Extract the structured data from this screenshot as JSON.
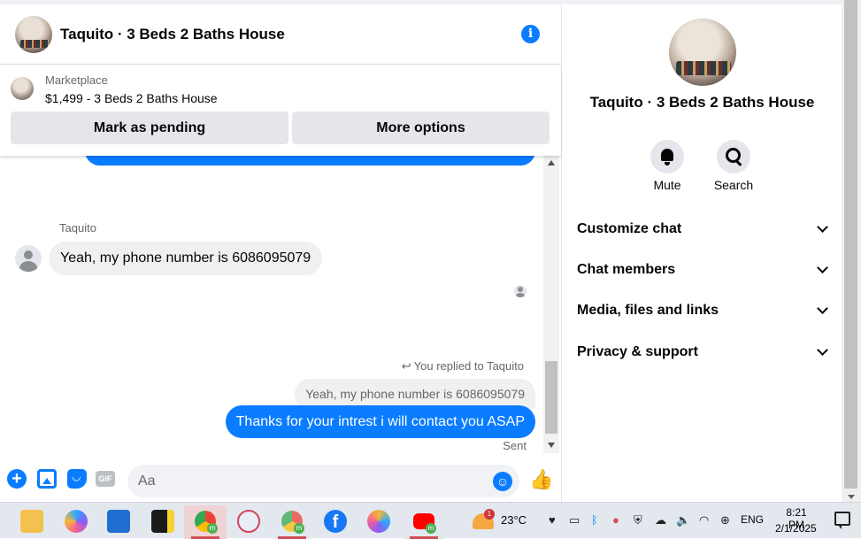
{
  "chat": {
    "title": "Taquito · 3 Beds 2 Baths House",
    "marketplace": {
      "source": "Marketplace",
      "listing": "$1,499 - 3 Beds 2 Baths House",
      "pending_label": "Mark as pending",
      "more_label": "More options"
    },
    "messages": {
      "sender_name": "Taquito",
      "incoming_text": "Yeah, my phone number is 6086095079",
      "replied_label": "You replied to Taquito",
      "quoted_text": "Yeah, my phone number is 6086095079",
      "outgoing_text": "Thanks for your intrest i will contact you ASAP",
      "status": "Sent"
    },
    "composer": {
      "placeholder": "Aa",
      "gif_label": "GIF"
    }
  },
  "info_panel": {
    "name": "Taquito · 3 Beds 2 Baths House",
    "actions": [
      {
        "label": "Mute",
        "icon": "bell-icon"
      },
      {
        "label": "Search",
        "icon": "search-icon"
      }
    ],
    "sections": [
      "Customize chat",
      "Chat members",
      "Media, files and links",
      "Privacy & support"
    ]
  },
  "taskbar": {
    "weather_temp": "23°C",
    "weather_badge": "1",
    "language": "ENG",
    "time": "8:21 PM",
    "date": "2/1/2025",
    "apps": [
      "file-explorer-icon",
      "copilot-icon",
      "store-icon",
      "sticky-notes-icon",
      "chrome-icon",
      "snipping-tool-icon",
      "chrome-profile-icon",
      "facebook-icon",
      "paint-icon",
      "youtube-icon"
    ]
  },
  "colors": {
    "accent": "#0a7cff",
    "bubble_in": "#f0f0f0",
    "taskbar": "#e3e8ef"
  }
}
